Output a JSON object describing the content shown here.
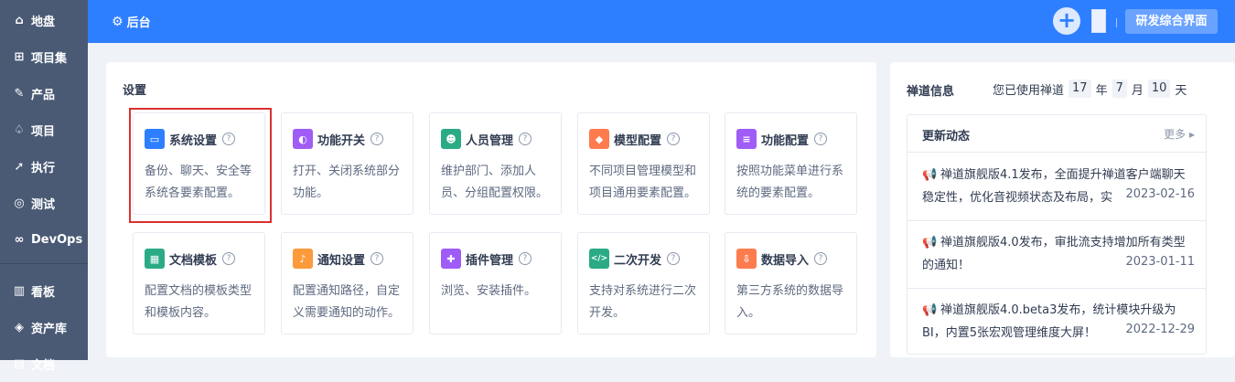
{
  "sidebar": {
    "items": [
      {
        "label": "地盘",
        "icon": "home-icon"
      },
      {
        "label": "项目集",
        "icon": "grid-icon"
      },
      {
        "label": "产品",
        "icon": "lightbulb-icon"
      },
      {
        "label": "项目",
        "icon": "rocket-icon"
      },
      {
        "label": "执行",
        "icon": "run-icon"
      },
      {
        "label": "测试",
        "icon": "search-icon"
      },
      {
        "label": "DevOps",
        "icon": "infinity-icon"
      },
      {
        "label": "看板",
        "icon": "kanban-icon"
      },
      {
        "label": "资产库",
        "icon": "diamond-icon"
      },
      {
        "label": "文档",
        "icon": "doc-icon"
      }
    ]
  },
  "topbar": {
    "title": "后台",
    "ui_switch_label": "研发综合界面",
    "colors": {
      "bar": "#2e7fff"
    }
  },
  "settings": {
    "title": "设置",
    "cards": [
      {
        "title": "系统设置",
        "desc": "备份、聊天、安全等系统各要素配置。",
        "icon": "monitor-icon",
        "color": "#2e7fff",
        "selected": true
      },
      {
        "title": "功能开关",
        "desc": "打开、关闭系统部分功能。",
        "icon": "toggle-icon",
        "color": "#9f5cf6"
      },
      {
        "title": "人员管理",
        "desc": "维护部门、添加人员、分组配置权限。",
        "icon": "users-icon",
        "color": "#2aab86"
      },
      {
        "title": "模型配置",
        "desc": "不同项目管理模型和项目通用要素配置。",
        "icon": "cube-icon",
        "color": "#fc7c4e"
      },
      {
        "title": "功能配置",
        "desc": "按照功能菜单进行系统的要素配置。",
        "icon": "sliders-icon",
        "color": "#9f5cf6"
      },
      {
        "title": "文档模板",
        "desc": "配置文档的模板类型和模板内容。",
        "icon": "template-icon",
        "color": "#2aab86"
      },
      {
        "title": "通知设置",
        "desc": "配置通知路径，自定义需要通知的动作。",
        "icon": "bell-icon",
        "color": "#fc9a3c"
      },
      {
        "title": "插件管理",
        "desc": "浏览、安装插件。",
        "icon": "puzzle-icon",
        "color": "#9f5cf6"
      },
      {
        "title": "二次开发",
        "desc": "支持对系统进行二次开发。",
        "icon": "code-icon",
        "color": "#2aab86"
      },
      {
        "title": "数据导入",
        "desc": "第三方系统的数据导入。",
        "icon": "import-icon",
        "color": "#fc7c4e"
      }
    ]
  },
  "info": {
    "title": "禅道信息",
    "usage_prefix": "您已使用禅道",
    "years": "17",
    "year_unit": "年",
    "months": "7",
    "month_unit": "月",
    "days": "10",
    "day_unit": "天",
    "news": {
      "title": "更新动态",
      "more": "更多",
      "items": [
        {
          "text": "禅道旗舰版4.1发布，全面提升禅道客户端聊天稳定性，优化音视频状态及布局，实",
          "date": "2023-02-16"
        },
        {
          "text": "禅道旗舰版4.0发布，审批流支持增加所有类型的通知！",
          "date": "2023-01-11"
        },
        {
          "text": "禅道旗舰版4.0.beta3发布，统计模块升级为BI，内置5张宏观管理维度大屏！",
          "date": "2022-12-29"
        }
      ]
    }
  }
}
